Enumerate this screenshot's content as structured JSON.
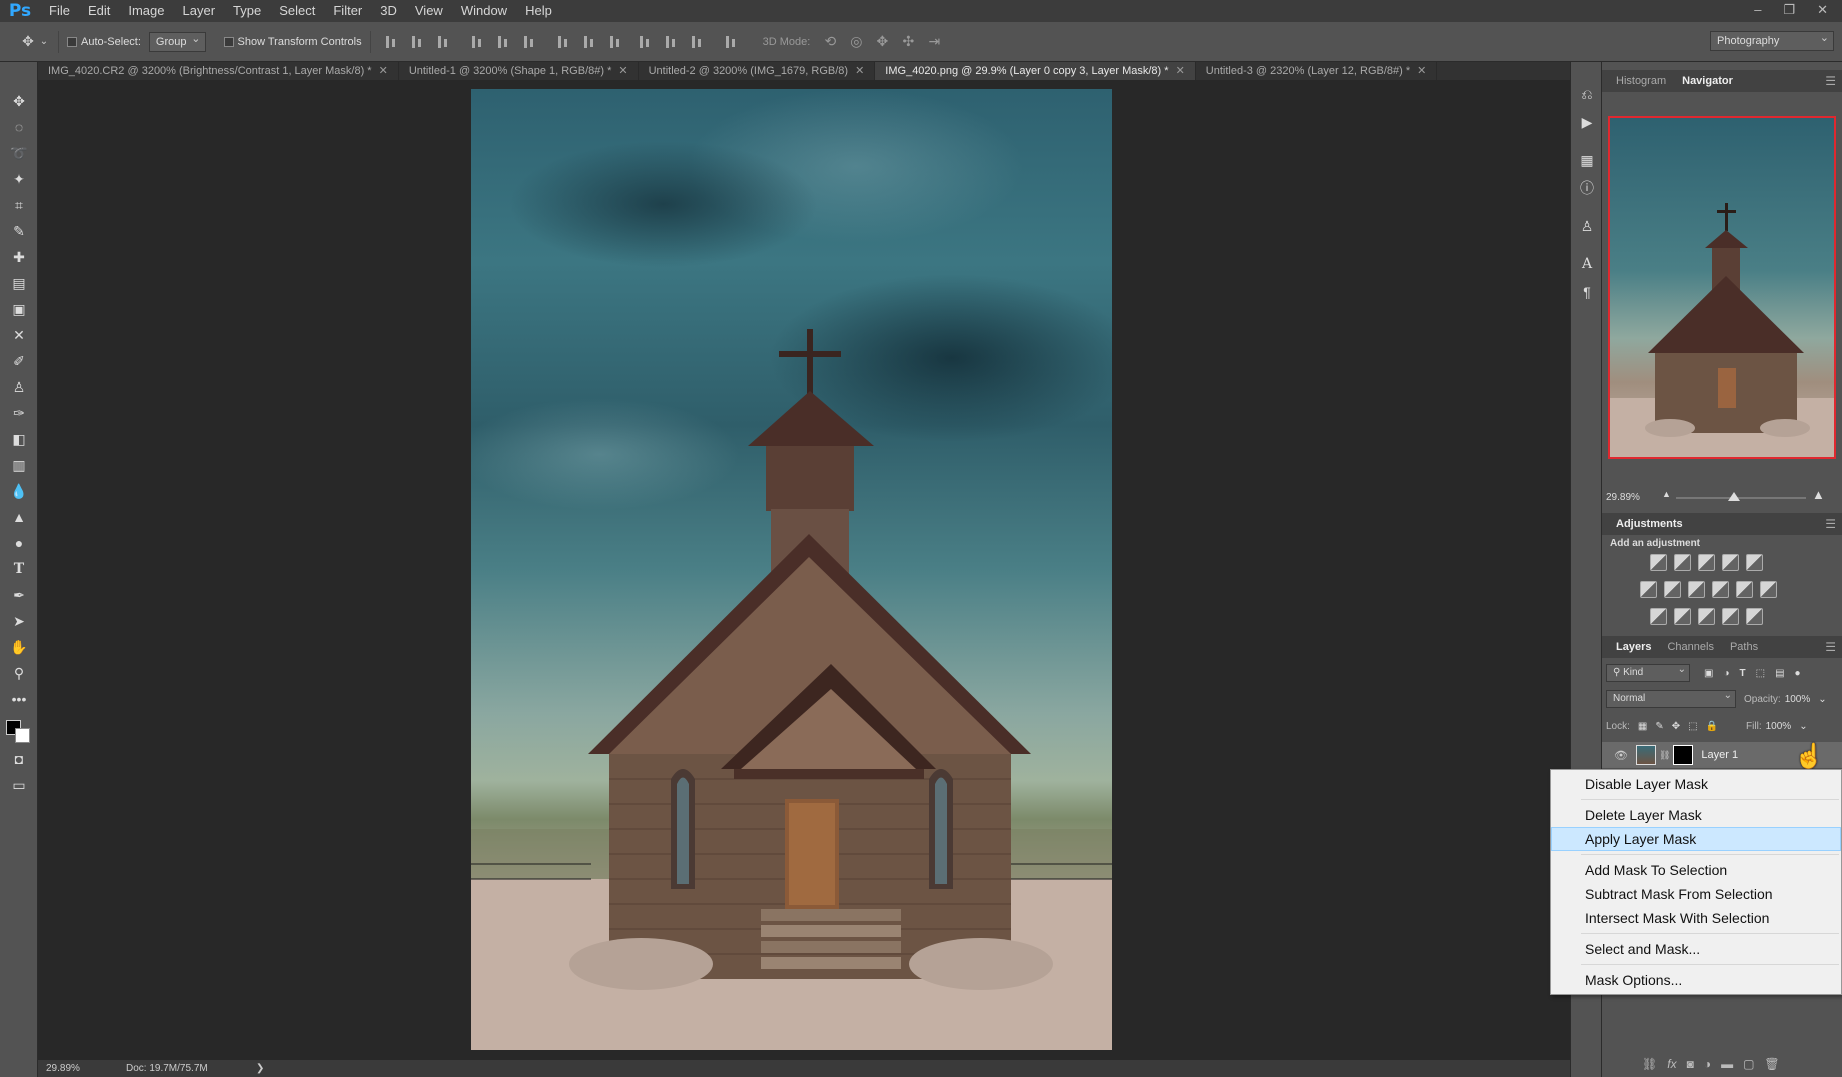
{
  "app": {
    "logo": "Ps",
    "menu": [
      "File",
      "Edit",
      "Image",
      "Layer",
      "Type",
      "Select",
      "Filter",
      "3D",
      "View",
      "Window",
      "Help"
    ],
    "window_controls": [
      "–",
      "❐",
      "✕"
    ]
  },
  "options_bar": {
    "auto_select_label": "Auto-Select:",
    "auto_select_value": "Group",
    "show_transform_label": "Show Transform Controls",
    "mode_3d_label": "3D Mode:",
    "workspace": "Photography"
  },
  "tabs": [
    {
      "label": "IMG_4020.CR2 @ 3200% (Brightness/Contrast 1, Layer Mask/8) *",
      "active": false
    },
    {
      "label": "Untitled-1 @ 3200% (Shape 1, RGB/8#) *",
      "active": false
    },
    {
      "label": "Untitled-2 @ 3200% (IMG_1679, RGB/8)",
      "active": false
    },
    {
      "label": "IMG_4020.png @ 29.9% (Layer 0 copy 3, Layer Mask/8) *",
      "active": true
    },
    {
      "label": "Untitled-3 @ 2320% (Layer 12, RGB/8#) *",
      "active": false
    }
  ],
  "status_bar": {
    "zoom": "29.89%",
    "doc": "Doc: 19.7M/75.7M",
    "arrow": "❯"
  },
  "navigator": {
    "tabs": [
      "Histogram",
      "Navigator"
    ],
    "active_tab": "Navigator",
    "zoom": "29.89%"
  },
  "adjustments": {
    "title": "Adjustments",
    "subtitle": "Add an adjustment"
  },
  "layers": {
    "tabs": [
      "Layers",
      "Channels",
      "Paths"
    ],
    "active_tab": "Layers",
    "filter_kind": "Kind",
    "blend_mode": "Normal",
    "opacity_label": "Opacity:",
    "opacity_value": "100%",
    "lock_label": "Lock:",
    "fill_label": "Fill:",
    "fill_value": "100%",
    "layer_name": "Layer 1"
  },
  "context_menu": {
    "items": [
      {
        "label": "Disable Layer Mask",
        "highlighted": false
      },
      {
        "label": "Delete Layer Mask",
        "highlighted": false
      },
      {
        "label": "Apply Layer Mask",
        "highlighted": true
      },
      {
        "label": "Add Mask To Selection",
        "highlighted": false
      },
      {
        "label": "Subtract Mask From Selection",
        "highlighted": false
      },
      {
        "label": "Intersect Mask With Selection",
        "highlighted": false
      },
      {
        "label": "Select and Mask...",
        "highlighted": false
      },
      {
        "label": "Mask Options...",
        "highlighted": false
      }
    ]
  },
  "colors": {
    "accent_logo": "#31a8ff",
    "nav_frame": "#e0282f",
    "menu_highlight": "#cce8ff"
  }
}
